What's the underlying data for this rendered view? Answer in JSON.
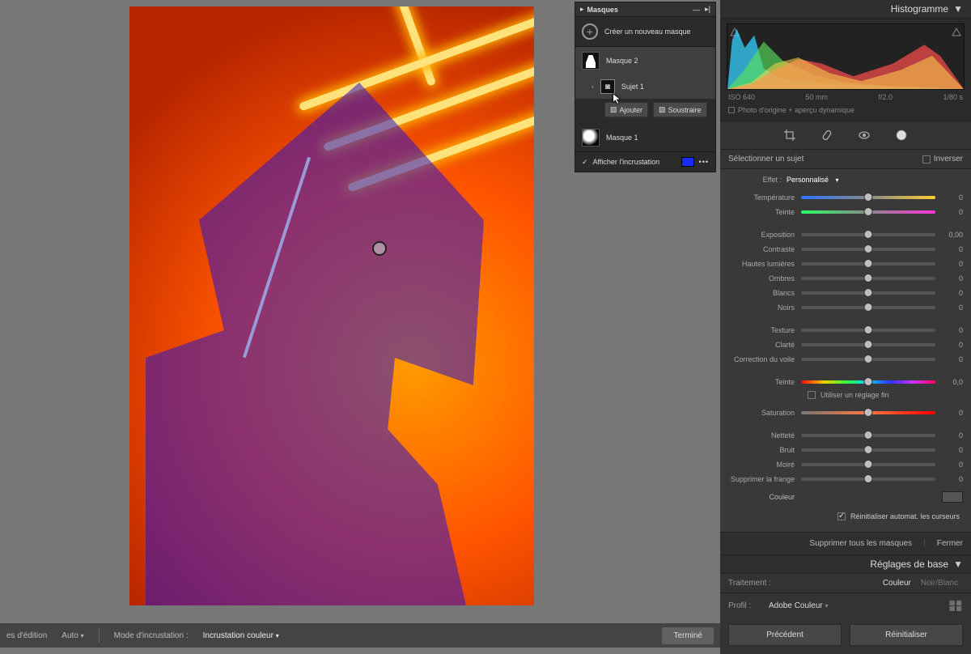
{
  "bottomBar": {
    "edits": "es d'édition",
    "auto": "Auto",
    "modeLabel": "Mode d'incrustation :",
    "modeValue": "Incrustation couleur",
    "done": "Terminé"
  },
  "maskPanel": {
    "title": "Masques",
    "create": "Créer un nouveau masque",
    "mask2": "Masque 2",
    "subject1": "Sujet 1",
    "add": "Ajouter",
    "subtract": "Soustraire",
    "mask1": "Masque 1",
    "showOverlay": "Afficher l'incrustation",
    "overlayColor": "#1a2bff"
  },
  "histogram": {
    "title": "Histogramme",
    "iso": "ISO 640",
    "focal": "50 mm",
    "aperture": "f/2.0",
    "shutter": "1/80 s",
    "note": "Photo d'origine + aperçu dynamique"
  },
  "selectRow": {
    "label": "Sélectionner un sujet",
    "invert": "Inverser"
  },
  "mode": {
    "left": "Effet :",
    "value": "Personnalisé"
  },
  "sliders": {
    "temperature": {
      "label": "Température",
      "value": "0"
    },
    "tint": {
      "label": "Teinte",
      "value": "0"
    },
    "exposure": {
      "label": "Exposition",
      "value": "0,00"
    },
    "contrast": {
      "label": "Contraste",
      "value": "0"
    },
    "highlights": {
      "label": "Hautes lumières",
      "value": "0"
    },
    "shadows": {
      "label": "Ombres",
      "value": "0"
    },
    "whites": {
      "label": "Blancs",
      "value": "0"
    },
    "blacks": {
      "label": "Noirs",
      "value": "0"
    },
    "texture": {
      "label": "Texture",
      "value": "0"
    },
    "clarity": {
      "label": "Clarté",
      "value": "0"
    },
    "dehaze": {
      "label": "Correction du voile",
      "value": "0"
    },
    "hue": {
      "label": "Teinte",
      "value": "0,0"
    },
    "fine": "Utiliser un réglage fin",
    "saturation": {
      "label": "Saturation",
      "value": "0"
    },
    "sharpness": {
      "label": "Netteté",
      "value": "0"
    },
    "noise": {
      "label": "Bruit",
      "value": "0"
    },
    "moire": {
      "label": "Moiré",
      "value": "0"
    },
    "defringe": {
      "label": "Supprimer la frange",
      "value": "0"
    },
    "colorLabel": "Couleur",
    "reset": "Réinitialiser automat. les curseurs"
  },
  "footer": {
    "deleteAll": "Supprimer tous les masques",
    "close": "Fermer"
  },
  "basic": {
    "title": "Réglages de base",
    "treatLabel": "Traitement :",
    "color": "Couleur",
    "bw": "Noir/Blanc",
    "profileLabel": "Profil :",
    "profileValue": "Adobe Couleur",
    "prev": "Précédent",
    "reinit": "Réinitialiser"
  }
}
